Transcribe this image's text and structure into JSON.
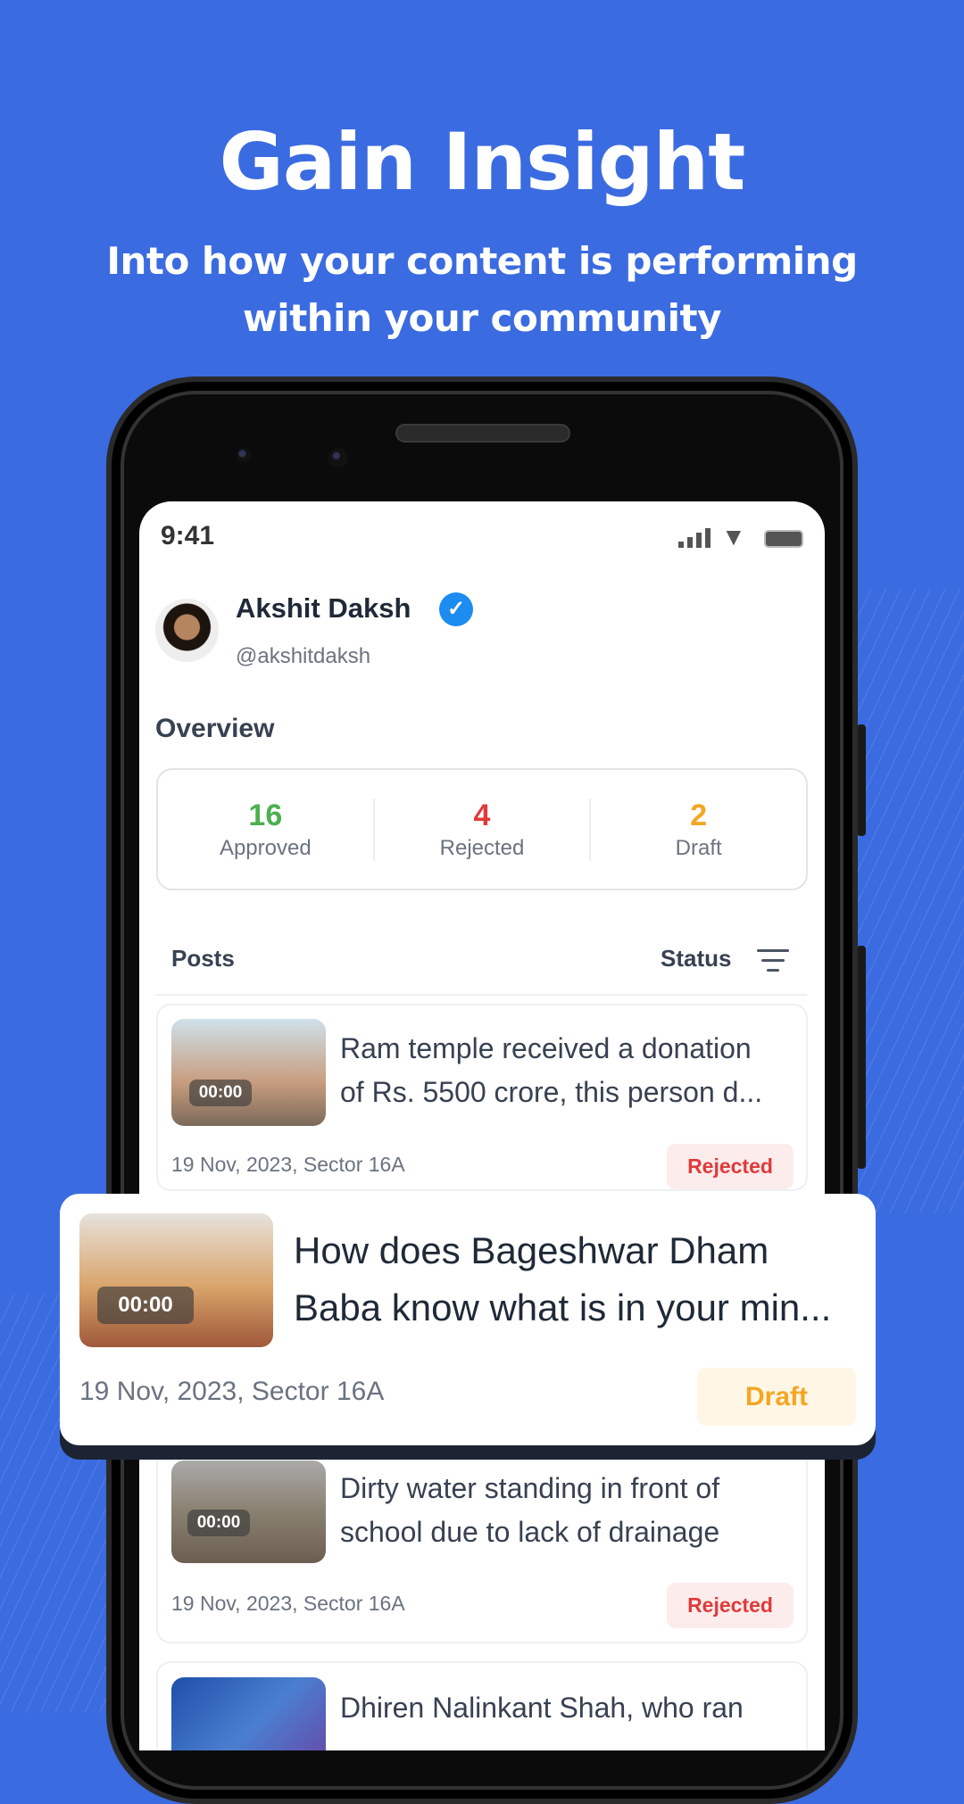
{
  "promo": {
    "title": "Gain Insight",
    "subtitle_line1": "Into how your content is performing",
    "subtitle_line2": "within your community"
  },
  "status_bar": {
    "time": "9:41",
    "icons": [
      "signal-icon",
      "wifi-icon",
      "battery-icon"
    ]
  },
  "profile": {
    "name": "Akshit Daksh",
    "handle": "@akshitdaksh",
    "verified_icon": "✓"
  },
  "overview": {
    "title": "Overview",
    "stats": [
      {
        "value": "16",
        "label": "Approved",
        "color": "#4caf50"
      },
      {
        "value": "4",
        "label": "Rejected",
        "color": "#e03a3a"
      },
      {
        "value": "2",
        "label": "Draft",
        "color": "#f5a623"
      }
    ]
  },
  "posts_header": {
    "posts": "Posts",
    "status": "Status"
  },
  "posts": [
    {
      "title_line1": "Ram temple received a donation",
      "title_line2": "of Rs. 5500 crore, this person d...",
      "duration": "00:00",
      "meta": "19 Nov, 2023, Sector 16A",
      "status": "Rejected"
    },
    {
      "title_line1": "How does Bageshwar Dham",
      "title_line2": "Baba know what is in your min...",
      "duration": "00:00",
      "meta": "19 Nov, 2023, Sector 16A",
      "status": "Draft"
    },
    {
      "title_line1": "Dirty water standing in front of",
      "title_line2": "school due to lack of drainage",
      "duration": "00:00",
      "meta": "19 Nov, 2023, Sector 16A",
      "status": "Rejected"
    },
    {
      "title_line1": "Dhiren Nalinkant Shah, who ran"
    }
  ]
}
